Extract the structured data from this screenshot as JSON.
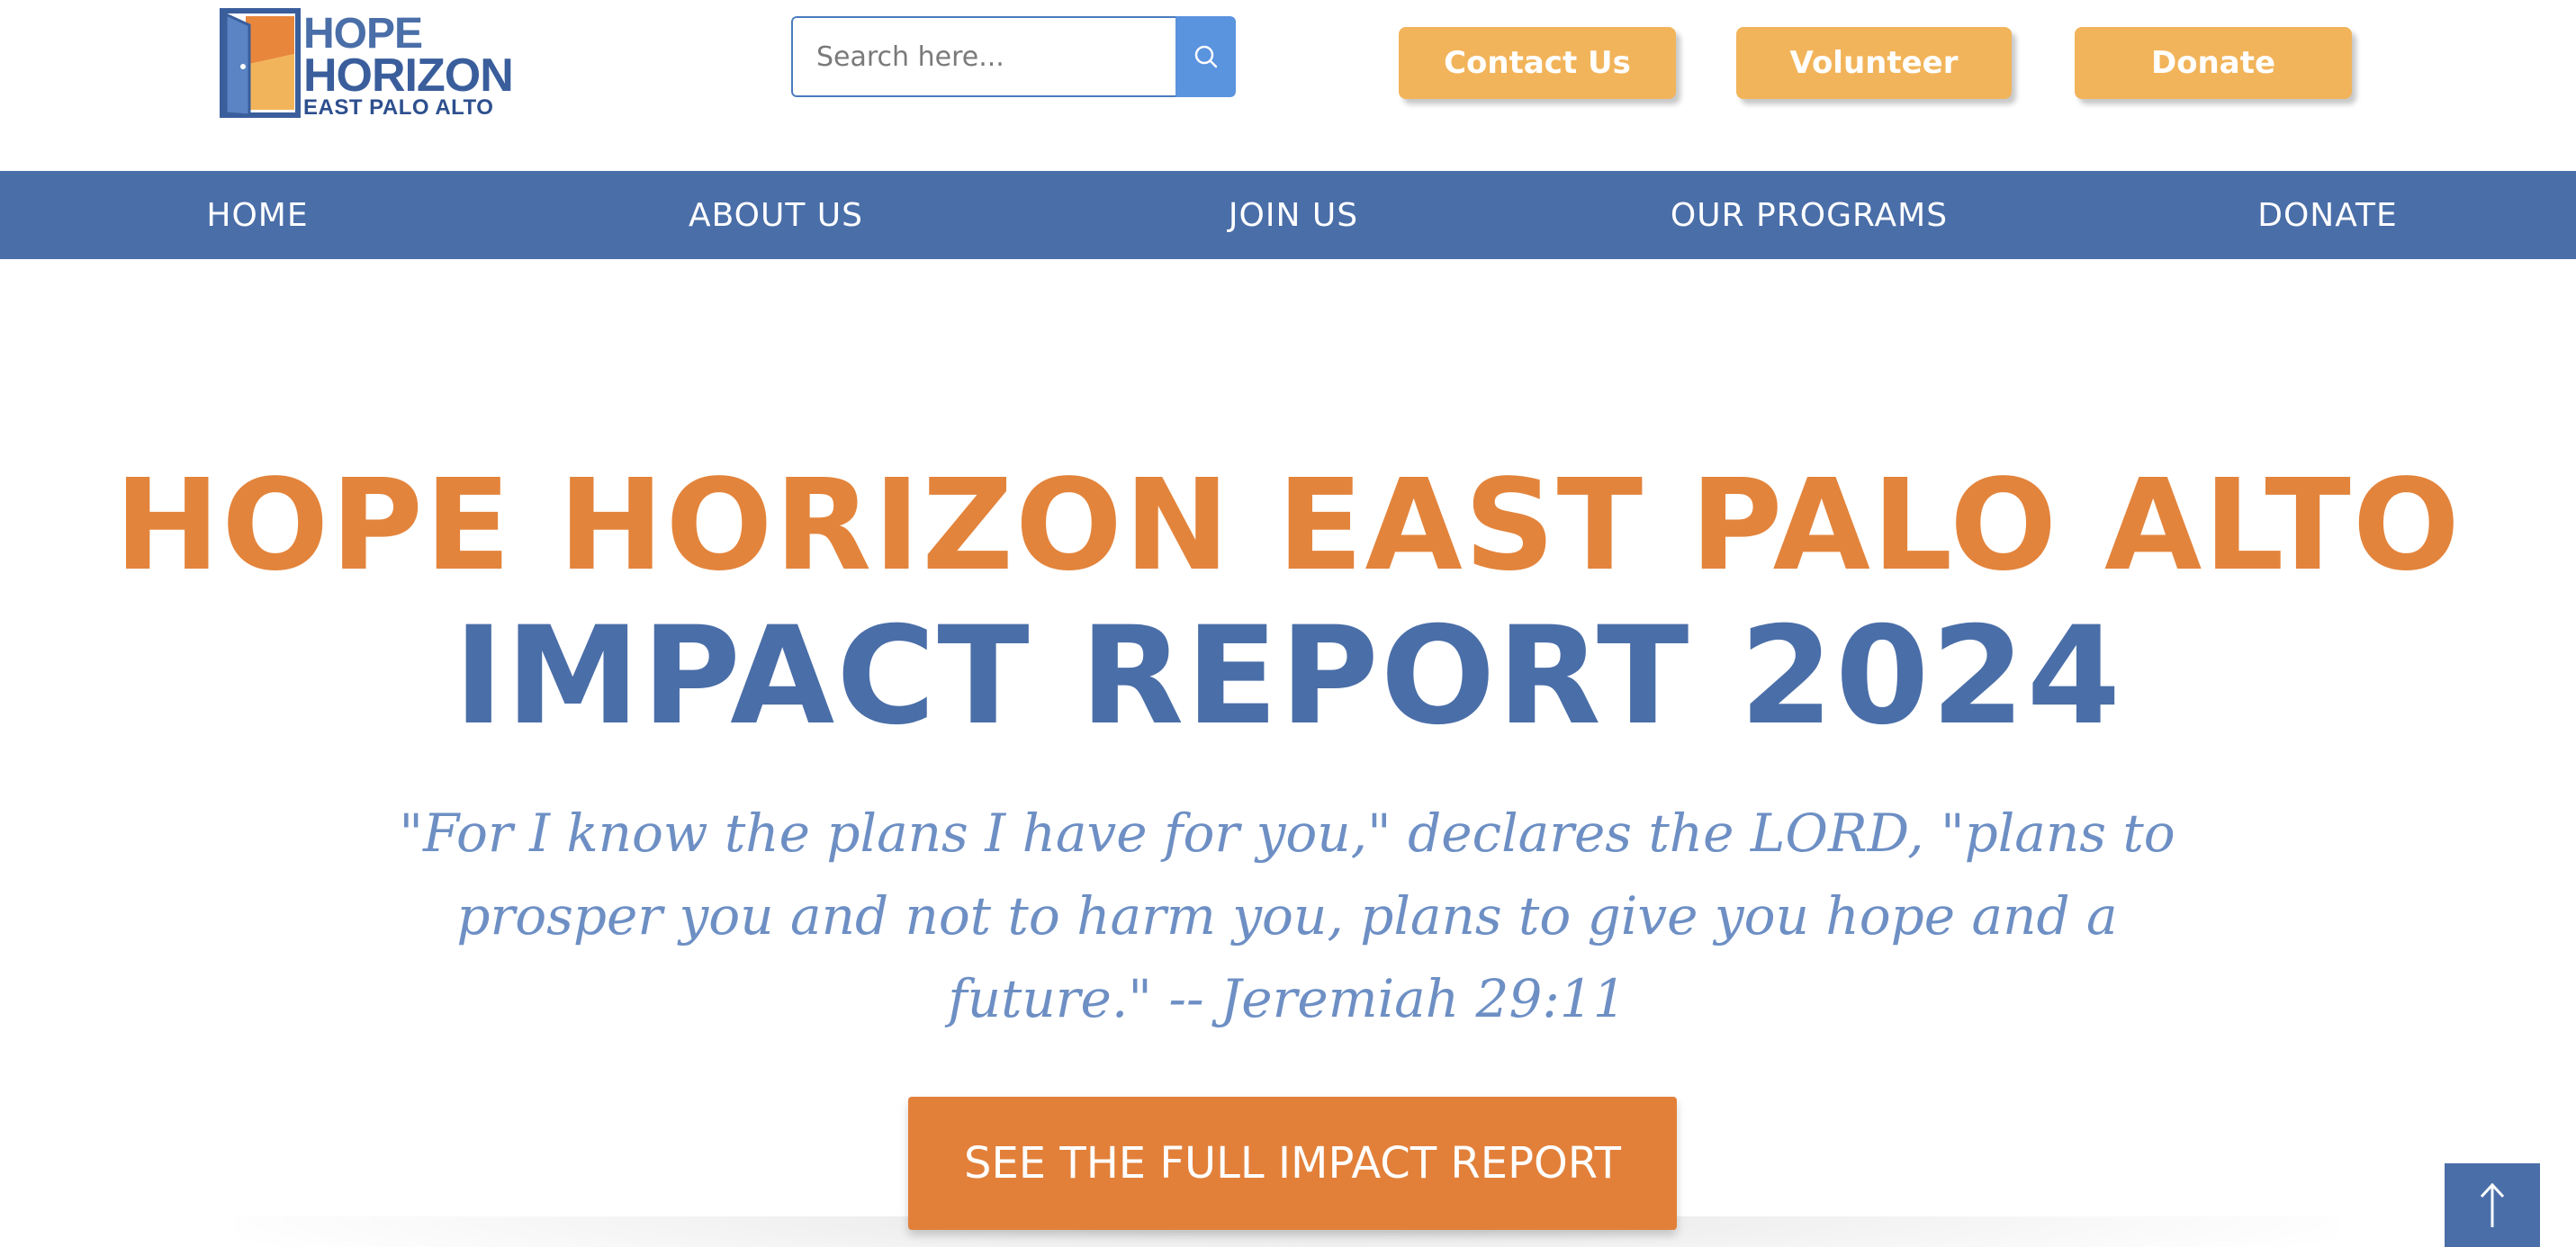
{
  "brand": {
    "line1": "HOPE",
    "line2": "HORIZON",
    "line3": "EAST PALO ALTO"
  },
  "search": {
    "placeholder": "Search here...",
    "icon": "search-icon"
  },
  "header_buttons": {
    "contact": "Contact Us",
    "volunteer": "Volunteer",
    "donate": "Donate"
  },
  "nav": {
    "home": "HOME",
    "about": "ABOUT US",
    "join": "JOIN US",
    "programs": "OUR PROGRAMS",
    "donate": "DONATE"
  },
  "hero": {
    "title_line1": "HOPE HORIZON EAST PALO ALTO",
    "title_line2": "IMPACT REPORT 2024",
    "quote": "\"For I know the plans I have for you,\" declares the LORD, \"plans to prosper you and not to harm you, plans to give you hope and a future.\" -- Jeremiah 29:11",
    "cta": "SEE THE FULL IMPACT REPORT"
  },
  "scroll_top": {
    "icon": "arrow-up-icon"
  },
  "colors": {
    "brand_blue": "#4a6ea8",
    "brand_orange": "#e3843c",
    "button_gold": "#f2b45a",
    "search_blue": "#5a93de",
    "quote_blue": "#6d8fc4"
  }
}
